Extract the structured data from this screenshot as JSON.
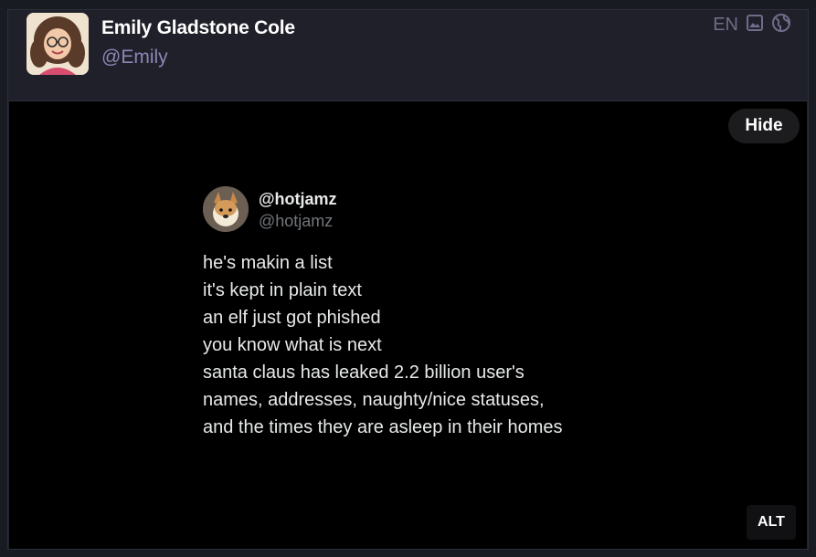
{
  "post": {
    "display_name": "Emily Gladstone Cole",
    "handle": "@Emily",
    "language": "EN",
    "icons": [
      "image-icon",
      "globe-icon"
    ]
  },
  "media": {
    "hide_label": "Hide",
    "alt_label": "ALT",
    "tweet": {
      "name": "@hotjamz",
      "handle": "@hotjamz",
      "lines": [
        "he's makin a list",
        "it's kept in plain text",
        "an elf just got phished",
        "you know what is next",
        "santa claus has leaked 2.2 billion user's",
        "names, addresses, naughty/nice statuses,",
        "and the times they are asleep in their homes"
      ]
    }
  },
  "colors": {
    "background": "#191b22",
    "card": "#1f2029",
    "handle": "#8b87b6",
    "media_bg": "#000000"
  }
}
